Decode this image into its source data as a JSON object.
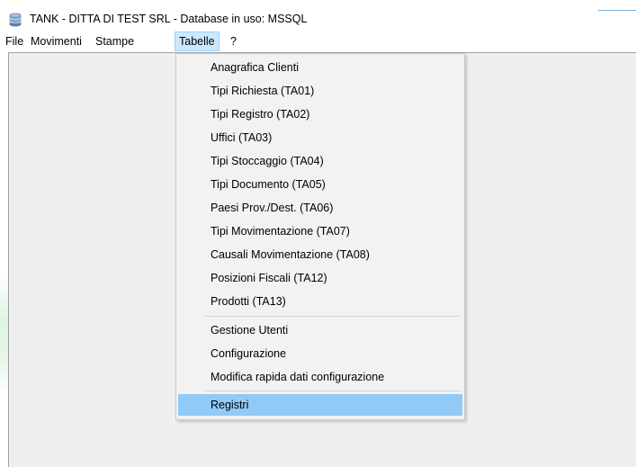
{
  "window": {
    "title": "TANK - DITTA DI TEST SRL - Database in uso: MSSQL",
    "icon": "database-icon"
  },
  "menubar": {
    "items": [
      {
        "label": "File"
      },
      {
        "label": "Movimenti"
      },
      {
        "label": "Stampe"
      },
      {
        "label": "Tabelle",
        "open": true
      },
      {
        "label": "?"
      }
    ]
  },
  "dropdown": {
    "groups": [
      [
        "Anagrafica Clienti",
        "Tipi Richiesta (TA01)",
        "Tipi Registro (TA02)",
        "Uffici (TA03)",
        "Tipi Stoccaggio (TA04)",
        "Tipi Documento (TA05)",
        "Paesi Prov./Dest. (TA06)",
        "Tipi Movimentazione (TA07)",
        "Causali Movimentazione (TA08)",
        "Posizioni Fiscali (TA12)",
        "Prodotti (TA13)"
      ],
      [
        "Gestione Utenti",
        "Configurazione",
        "Modifica rapida dati configurazione"
      ],
      [
        "Registri"
      ]
    ],
    "highlighted": "Registri"
  },
  "colors": {
    "menu_open_bg": "#cce8ff",
    "highlight_bg": "#91c9f7",
    "client_bg": "#efefef"
  }
}
